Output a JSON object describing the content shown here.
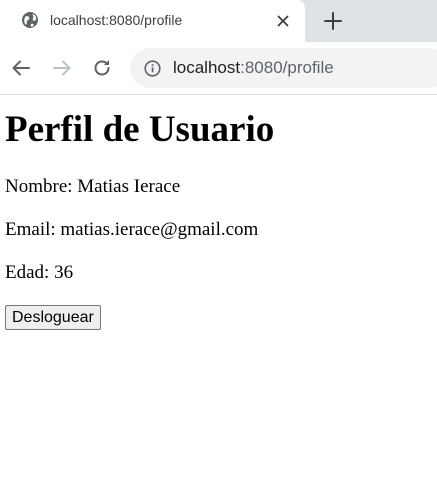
{
  "browser": {
    "tab": {
      "title": "localhost:8080/profile",
      "favicon": "globe-icon",
      "close_icon": "close-icon"
    },
    "new_tab_icon": "plus-icon",
    "nav": {
      "back_icon": "arrow-left-icon",
      "forward_icon": "arrow-right-icon",
      "reload_icon": "reload-icon"
    },
    "address_bar": {
      "info_icon": "info-icon",
      "url_host": "localhost",
      "url_rest": ":8080/profile"
    }
  },
  "page": {
    "title": "Perfil de Usuario",
    "name_line": "Nombre: Matias Ierace",
    "email_line": "Email: matias.ierace@gmail.com",
    "age_line": "Edad: 36",
    "logout_label": "Desloguear"
  },
  "colors": {
    "tabstrip_bg": "#dee1e6",
    "omnibox_bg": "#f1f3f4",
    "icon_gray": "#5f6368",
    "icon_disabled": "#bdc1c6"
  }
}
